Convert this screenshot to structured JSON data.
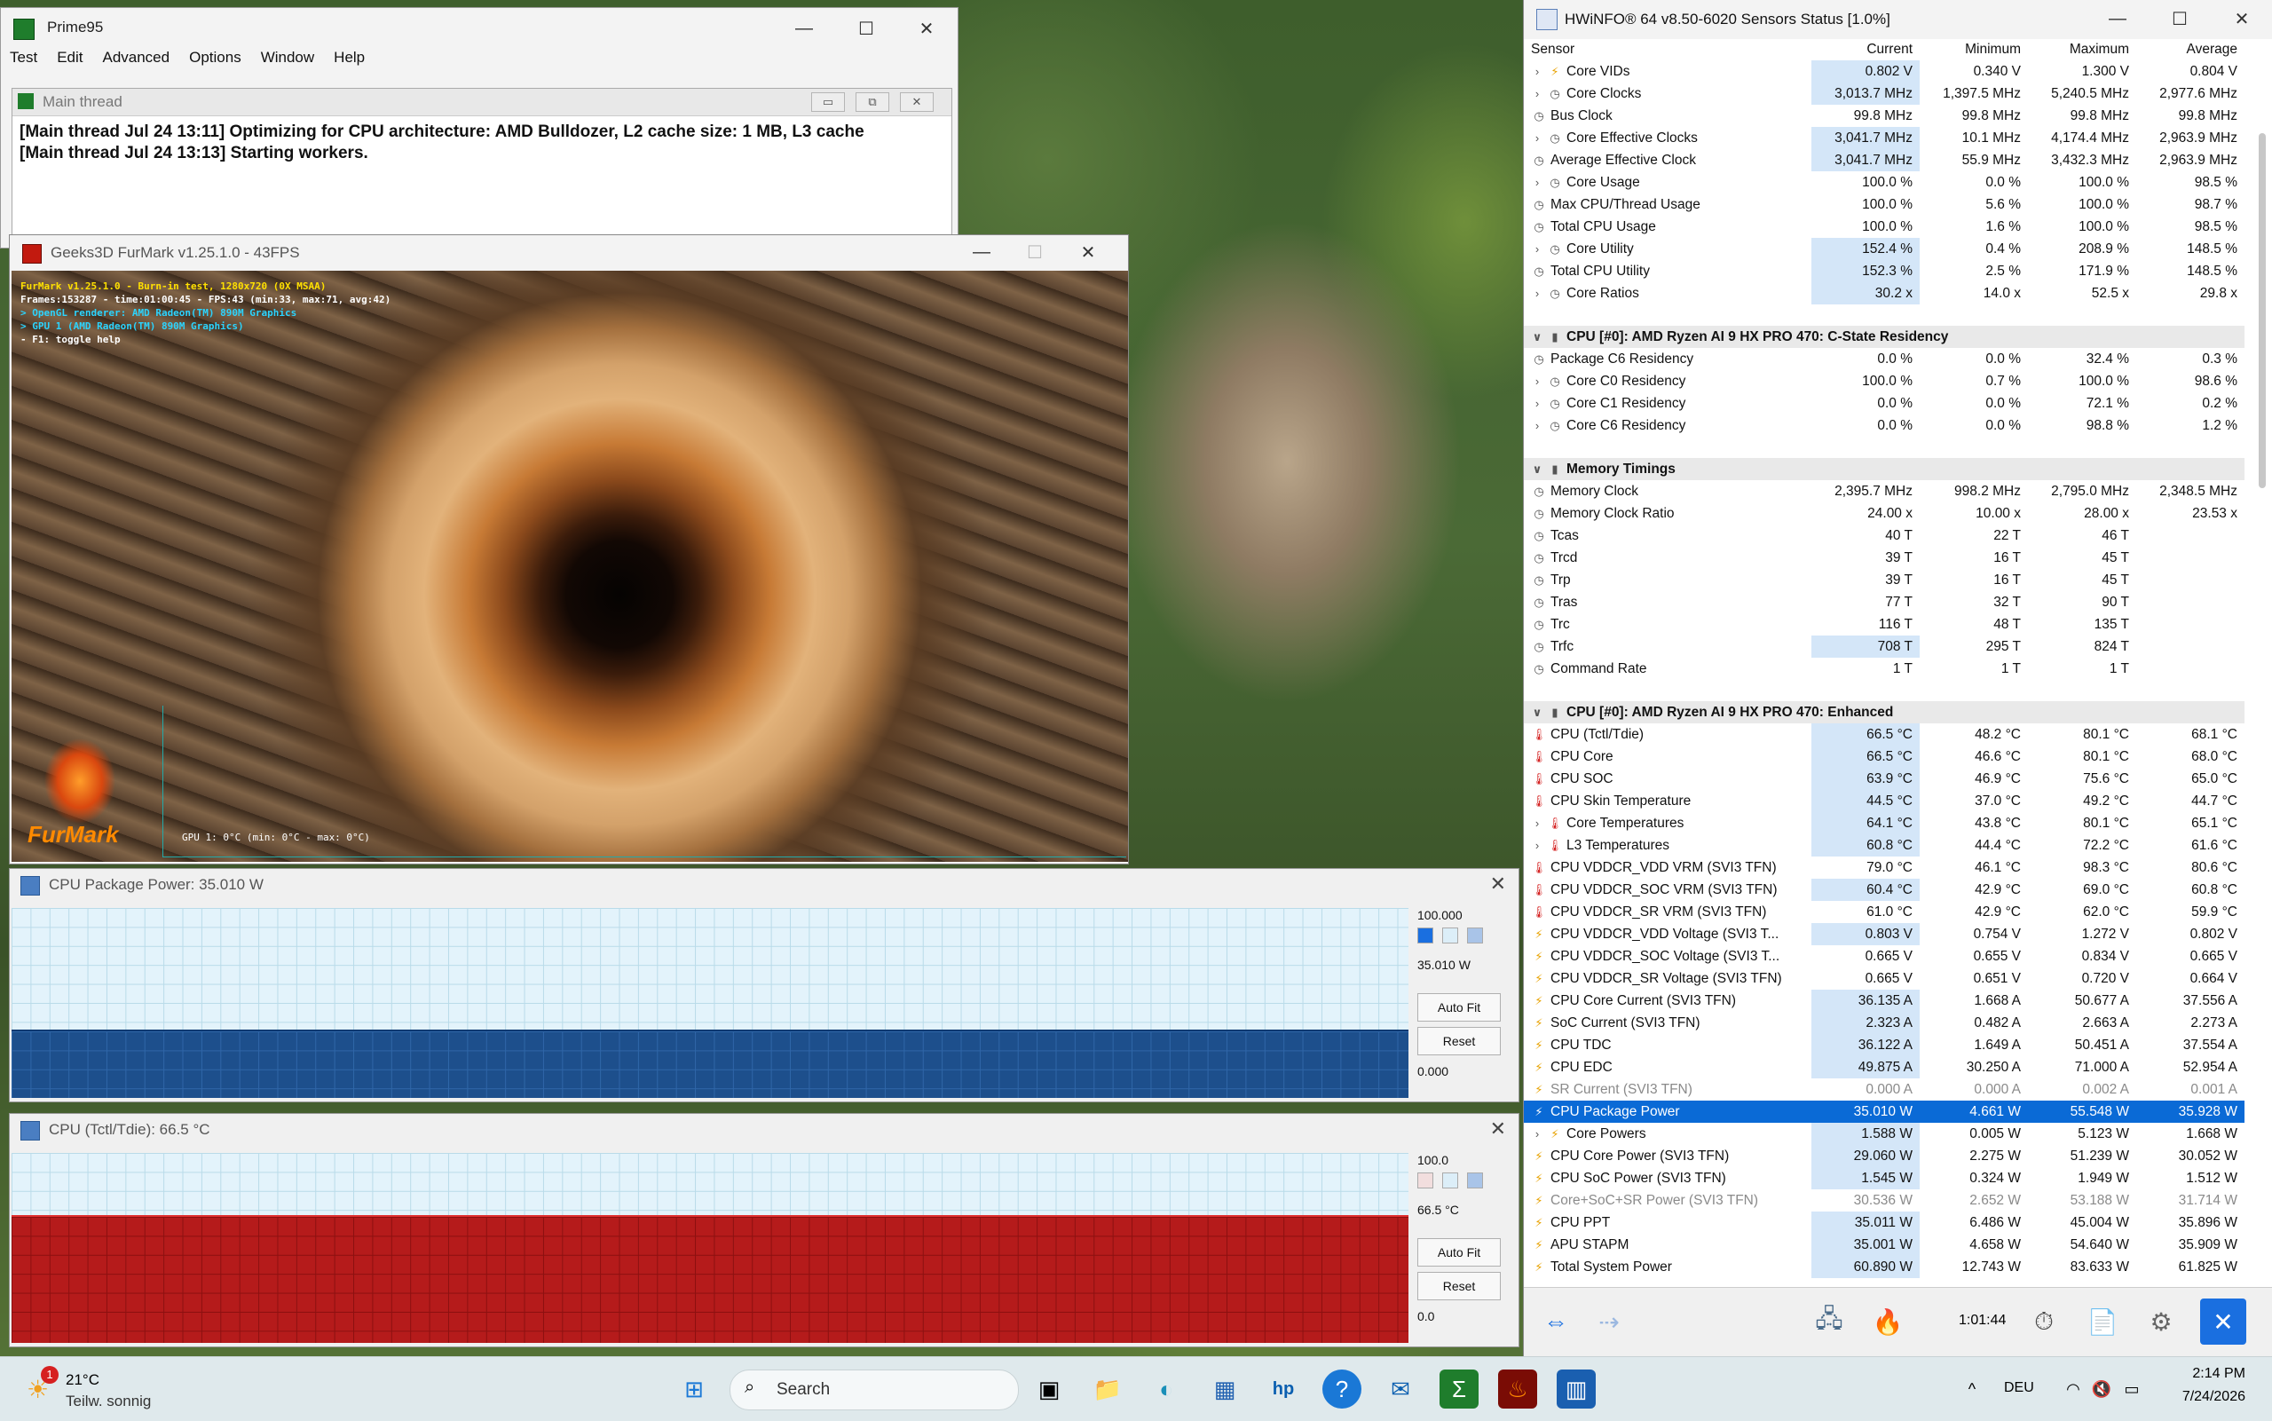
{
  "prime95": {
    "title": "Prime95",
    "menu": [
      "Test",
      "Edit",
      "Advanced",
      "Options",
      "Window",
      "Help"
    ],
    "child_title": "Main thread",
    "log": [
      "[Main thread Jul 24 13:11] Optimizing for CPU architecture: AMD Bulldozer, L2 cache size: 1 MB, L3 cache",
      "[Main thread Jul 24 13:13] Starting workers."
    ]
  },
  "furmark": {
    "title": "Geeks3D FurMark v1.25.1.0 - 43FPS",
    "overlay": [
      "FurMark v1.25.1.0 - Burn-in test, 1280x720 (0X MSAA)",
      "Frames:153287 - time:01:00:45 - FPS:43 (min:33, max:71, avg:42)",
      "> OpenGL renderer: AMD Radeon(TM) 890M Graphics",
      "> GPU 1 (AMD Radeon(TM) 890M Graphics)",
      "- F1: toggle help"
    ],
    "gpu_label": "GPU 1: 0°C (min: 0°C - max: 0°C)",
    "logo_text": "FurMark"
  },
  "power_graph": {
    "title": "CPU Package Power: 35.010 W",
    "max": "100.000",
    "current": "35.010 W",
    "min": "0.000",
    "autofit": "Auto Fit",
    "reset": "Reset",
    "level": 0.35
  },
  "temp_graph": {
    "title": "CPU (Tctl/Tdie): 66.5 °C",
    "max": "100.0",
    "current": "66.5 °C",
    "min": "0.0",
    "autofit": "Auto Fit",
    "reset": "Reset",
    "level": 0.665
  },
  "hwinfo": {
    "title": "HWiNFO® 64 v8.50-6020 Sensors Status [1.0%]",
    "headers": [
      "Sensor",
      "Current",
      "Minimum",
      "Maximum",
      "Average"
    ],
    "rows": [
      {
        "t": "r",
        "exp": true,
        "icon": "bolt",
        "name": "Core VIDs",
        "cur": "0.802 V",
        "min": "0.340 V",
        "max": "1.300 V",
        "avg": "0.804 V",
        "hl": true
      },
      {
        "t": "r",
        "exp": true,
        "icon": "clock",
        "name": "Core Clocks",
        "cur": "3,013.7 MHz",
        "min": "1,397.5 MHz",
        "max": "5,240.5 MHz",
        "avg": "2,977.6 MHz",
        "hl": true
      },
      {
        "t": "r",
        "exp": false,
        "icon": "clock",
        "name": "Bus Clock",
        "cur": "99.8 MHz",
        "min": "99.8 MHz",
        "max": "99.8 MHz",
        "avg": "99.8 MHz",
        "hl": false
      },
      {
        "t": "r",
        "exp": true,
        "icon": "clock",
        "name": "Core Effective Clocks",
        "cur": "3,041.7 MHz",
        "min": "10.1 MHz",
        "max": "4,174.4 MHz",
        "avg": "2,963.9 MHz",
        "hl": true
      },
      {
        "t": "r",
        "exp": false,
        "icon": "clock",
        "name": "Average Effective Clock",
        "cur": "3,041.7 MHz",
        "min": "55.9 MHz",
        "max": "3,432.3 MHz",
        "avg": "2,963.9 MHz",
        "hl": true
      },
      {
        "t": "r",
        "exp": true,
        "icon": "clock",
        "name": "Core Usage",
        "cur": "100.0 %",
        "min": "0.0 %",
        "max": "100.0 %",
        "avg": "98.5 %",
        "hl": false
      },
      {
        "t": "r",
        "exp": false,
        "icon": "clock",
        "name": "Max CPU/Thread Usage",
        "cur": "100.0 %",
        "min": "5.6 %",
        "max": "100.0 %",
        "avg": "98.7 %",
        "hl": false
      },
      {
        "t": "r",
        "exp": false,
        "icon": "clock",
        "name": "Total CPU Usage",
        "cur": "100.0 %",
        "min": "1.6 %",
        "max": "100.0 %",
        "avg": "98.5 %",
        "hl": false
      },
      {
        "t": "r",
        "exp": true,
        "icon": "clock",
        "name": "Core Utility",
        "cur": "152.4 %",
        "min": "0.4 %",
        "max": "208.9 %",
        "avg": "148.5 %",
        "hl": true
      },
      {
        "t": "r",
        "exp": false,
        "icon": "clock",
        "name": "Total CPU Utility",
        "cur": "152.3 %",
        "min": "2.5 %",
        "max": "171.9 %",
        "avg": "148.5 %",
        "hl": true
      },
      {
        "t": "r",
        "exp": true,
        "icon": "clock",
        "name": "Core Ratios",
        "cur": "30.2 x",
        "min": "14.0 x",
        "max": "52.5 x",
        "avg": "29.8 x",
        "hl": true
      },
      {
        "t": "blank"
      },
      {
        "t": "g",
        "name": "CPU [#0]: AMD Ryzen AI 9 HX PRO 470: C-State Residency"
      },
      {
        "t": "r",
        "exp": false,
        "icon": "clock",
        "name": "Package C6 Residency",
        "cur": "0.0 %",
        "min": "0.0 %",
        "max": "32.4 %",
        "avg": "0.3 %",
        "hl": false
      },
      {
        "t": "r",
        "exp": true,
        "icon": "clock",
        "name": "Core C0 Residency",
        "cur": "100.0 %",
        "min": "0.7 %",
        "max": "100.0 %",
        "avg": "98.6 %",
        "hl": false
      },
      {
        "t": "r",
        "exp": true,
        "icon": "clock",
        "name": "Core C1 Residency",
        "cur": "0.0 %",
        "min": "0.0 %",
        "max": "72.1 %",
        "avg": "0.2 %",
        "hl": false
      },
      {
        "t": "r",
        "exp": true,
        "icon": "clock",
        "name": "Core C6 Residency",
        "cur": "0.0 %",
        "min": "0.0 %",
        "max": "98.8 %",
        "avg": "1.2 %",
        "hl": false
      },
      {
        "t": "blank"
      },
      {
        "t": "g",
        "name": "Memory Timings"
      },
      {
        "t": "r",
        "exp": false,
        "icon": "clock",
        "name": "Memory Clock",
        "cur": "2,395.7 MHz",
        "min": "998.2 MHz",
        "max": "2,795.0 MHz",
        "avg": "2,348.5 MHz",
        "hl": false
      },
      {
        "t": "r",
        "exp": false,
        "icon": "clock",
        "name": "Memory Clock Ratio",
        "cur": "24.00 x",
        "min": "10.00 x",
        "max": "28.00 x",
        "avg": "23.53 x",
        "hl": false
      },
      {
        "t": "r",
        "exp": false,
        "icon": "clock",
        "name": "Tcas",
        "cur": "40 T",
        "min": "22 T",
        "max": "46 T",
        "avg": "",
        "hl": false
      },
      {
        "t": "r",
        "exp": false,
        "icon": "clock",
        "name": "Trcd",
        "cur": "39 T",
        "min": "16 T",
        "max": "45 T",
        "avg": "",
        "hl": false
      },
      {
        "t": "r",
        "exp": false,
        "icon": "clock",
        "name": "Trp",
        "cur": "39 T",
        "min": "16 T",
        "max": "45 T",
        "avg": "",
        "hl": false
      },
      {
        "t": "r",
        "exp": false,
        "icon": "clock",
        "name": "Tras",
        "cur": "77 T",
        "min": "32 T",
        "max": "90 T",
        "avg": "",
        "hl": false
      },
      {
        "t": "r",
        "exp": false,
        "icon": "clock",
        "name": "Trc",
        "cur": "116 T",
        "min": "48 T",
        "max": "135 T",
        "avg": "",
        "hl": false
      },
      {
        "t": "r",
        "exp": false,
        "icon": "clock",
        "name": "Trfc",
        "cur": "708 T",
        "min": "295 T",
        "max": "824 T",
        "avg": "",
        "hl": true
      },
      {
        "t": "r",
        "exp": false,
        "icon": "clock",
        "name": "Command Rate",
        "cur": "1 T",
        "min": "1 T",
        "max": "1 T",
        "avg": "",
        "hl": false
      },
      {
        "t": "blank"
      },
      {
        "t": "g",
        "name": "CPU [#0]: AMD Ryzen AI 9 HX PRO 470: Enhanced"
      },
      {
        "t": "r",
        "exp": false,
        "icon": "temp",
        "name": "CPU (Tctl/Tdie)",
        "cur": "66.5 °C",
        "min": "48.2 °C",
        "max": "80.1 °C",
        "avg": "68.1 °C",
        "hl": true
      },
      {
        "t": "r",
        "exp": false,
        "icon": "temp",
        "name": "CPU Core",
        "cur": "66.5 °C",
        "min": "46.6 °C",
        "max": "80.1 °C",
        "avg": "68.0 °C",
        "hl": true
      },
      {
        "t": "r",
        "exp": false,
        "icon": "temp",
        "name": "CPU SOC",
        "cur": "63.9 °C",
        "min": "46.9 °C",
        "max": "75.6 °C",
        "avg": "65.0 °C",
        "hl": true
      },
      {
        "t": "r",
        "exp": false,
        "icon": "temp",
        "name": "CPU Skin Temperature",
        "cur": "44.5 °C",
        "min": "37.0 °C",
        "max": "49.2 °C",
        "avg": "44.7 °C",
        "hl": true
      },
      {
        "t": "r",
        "exp": true,
        "icon": "temp",
        "name": "Core Temperatures",
        "cur": "64.1 °C",
        "min": "43.8 °C",
        "max": "80.1 °C",
        "avg": "65.1 °C",
        "hl": true
      },
      {
        "t": "r",
        "exp": true,
        "icon": "temp",
        "name": "L3 Temperatures",
        "cur": "60.8 °C",
        "min": "44.4 °C",
        "max": "72.2 °C",
        "avg": "61.6 °C",
        "hl": true
      },
      {
        "t": "r",
        "exp": false,
        "icon": "temp",
        "name": "CPU VDDCR_VDD VRM (SVI3 TFN)",
        "cur": "79.0 °C",
        "min": "46.1 °C",
        "max": "98.3 °C",
        "avg": "80.6 °C",
        "hl": false
      },
      {
        "t": "r",
        "exp": false,
        "icon": "temp",
        "name": "CPU VDDCR_SOC VRM (SVI3 TFN)",
        "cur": "60.4 °C",
        "min": "42.9 °C",
        "max": "69.0 °C",
        "avg": "60.8 °C",
        "hl": true
      },
      {
        "t": "r",
        "exp": false,
        "icon": "temp",
        "name": "CPU VDDCR_SR VRM (SVI3 TFN)",
        "cur": "61.0 °C",
        "min": "42.9 °C",
        "max": "62.0 °C",
        "avg": "59.9 °C",
        "hl": false
      },
      {
        "t": "r",
        "exp": false,
        "icon": "bolt",
        "name": "CPU VDDCR_VDD Voltage (SVI3 T...",
        "cur": "0.803 V",
        "min": "0.754 V",
        "max": "1.272 V",
        "avg": "0.802 V",
        "hl": true
      },
      {
        "t": "r",
        "exp": false,
        "icon": "bolt",
        "name": "CPU VDDCR_SOC Voltage (SVI3 T...",
        "cur": "0.665 V",
        "min": "0.655 V",
        "max": "0.834 V",
        "avg": "0.665 V",
        "hl": false
      },
      {
        "t": "r",
        "exp": false,
        "icon": "bolt",
        "name": "CPU VDDCR_SR Voltage (SVI3 TFN)",
        "cur": "0.665 V",
        "min": "0.651 V",
        "max": "0.720 V",
        "avg": "0.664 V",
        "hl": false
      },
      {
        "t": "r",
        "exp": false,
        "icon": "bolt",
        "name": "CPU Core Current (SVI3 TFN)",
        "cur": "36.135 A",
        "min": "1.668 A",
        "max": "50.677 A",
        "avg": "37.556 A",
        "hl": true
      },
      {
        "t": "r",
        "exp": false,
        "icon": "bolt",
        "name": "SoC Current (SVI3 TFN)",
        "cur": "2.323 A",
        "min": "0.482 A",
        "max": "2.663 A",
        "avg": "2.273 A",
        "hl": true
      },
      {
        "t": "r",
        "exp": false,
        "icon": "bolt",
        "name": "CPU TDC",
        "cur": "36.122 A",
        "min": "1.649 A",
        "max": "50.451 A",
        "avg": "37.554 A",
        "hl": true
      },
      {
        "t": "r",
        "exp": false,
        "icon": "bolt",
        "name": "CPU EDC",
        "cur": "49.875 A",
        "min": "30.250 A",
        "max": "71.000 A",
        "avg": "52.954 A",
        "hl": true
      },
      {
        "t": "r",
        "exp": false,
        "icon": "bolt",
        "name": "SR Current (SVI3 TFN)",
        "cur": "0.000 A",
        "min": "0.000 A",
        "max": "0.002 A",
        "avg": "0.001 A",
        "hl": false,
        "dimvals": true
      },
      {
        "t": "r",
        "exp": false,
        "icon": "bolt",
        "name": "CPU Package Power",
        "cur": "35.010 W",
        "min": "4.661 W",
        "max": "55.548 W",
        "avg": "35.928 W",
        "hl": true,
        "sel": true
      },
      {
        "t": "r",
        "exp": true,
        "icon": "bolt",
        "name": "Core Powers",
        "cur": "1.588 W",
        "min": "0.005 W",
        "max": "5.123 W",
        "avg": "1.668 W",
        "hl": true
      },
      {
        "t": "r",
        "exp": false,
        "icon": "bolt",
        "name": "CPU Core Power (SVI3 TFN)",
        "cur": "29.060 W",
        "min": "2.275 W",
        "max": "51.239 W",
        "avg": "30.052 W",
        "hl": true
      },
      {
        "t": "r",
        "exp": false,
        "icon": "bolt",
        "name": "CPU SoC Power (SVI3 TFN)",
        "cur": "1.545 W",
        "min": "0.324 W",
        "max": "1.949 W",
        "avg": "1.512 W",
        "hl": true
      },
      {
        "t": "r",
        "exp": false,
        "icon": "bolt",
        "name": "Core+SoC+SR Power (SVI3 TFN)",
        "cur": "30.536 W",
        "min": "2.652 W",
        "max": "53.188 W",
        "avg": "31.714 W",
        "hl": false,
        "dimvals": true
      },
      {
        "t": "r",
        "exp": false,
        "icon": "bolt",
        "name": "CPU PPT",
        "cur": "35.011 W",
        "min": "6.486 W",
        "max": "45.004 W",
        "avg": "35.896 W",
        "hl": true
      },
      {
        "t": "r",
        "exp": false,
        "icon": "bolt",
        "name": "APU STAPM",
        "cur": "35.001 W",
        "min": "4.658 W",
        "max": "54.640 W",
        "avg": "35.909 W",
        "hl": true
      },
      {
        "t": "r",
        "exp": false,
        "icon": "bolt",
        "name": "Total System Power",
        "cur": "60.890 W",
        "min": "12.743 W",
        "max": "83.633 W",
        "avg": "61.825 W",
        "hl": true
      }
    ],
    "timer": "1:01:44"
  },
  "taskbar": {
    "weather_temp": "21°C",
    "weather_desc": "Teilw. sonnig",
    "weather_badge": "1",
    "search_placeholder": "Search",
    "lang": "DEU",
    "time": "2:14 PM",
    "date": "7/24/2026"
  },
  "colors": {
    "selection": "#0a6ad6",
    "highlight": "#d4e6f8",
    "power_fill": "#1d4f8c",
    "temp_fill": "#b51b1b"
  }
}
